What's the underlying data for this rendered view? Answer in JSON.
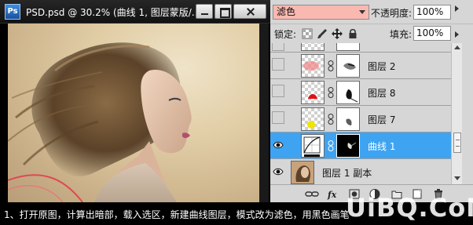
{
  "document": {
    "title": "PSD.psd @ 30.2% (曲线 1, 图层蒙版/...",
    "app_icon": "Ps"
  },
  "layers_panel": {
    "blend_mode": "滤色",
    "opacity_label": "不透明度:",
    "opacity_value": "100%",
    "lock_label": "锁定:",
    "fill_label": "填充:",
    "fill_value": "100%",
    "layers": [
      {
        "name": "图层 2",
        "visible": false,
        "thumb": "checker-pink",
        "has_mask": true
      },
      {
        "name": "图层 8",
        "visible": false,
        "thumb": "checker-red",
        "has_mask": true
      },
      {
        "name": "图层 7",
        "visible": false,
        "thumb": "checker-yellow",
        "has_mask": true
      },
      {
        "name": "曲线 1",
        "visible": true,
        "thumb": "curves-adjustment",
        "has_mask": true,
        "selected": true
      },
      {
        "name": "图层 1 副本",
        "visible": true,
        "thumb": "photo",
        "has_mask": false
      }
    ]
  },
  "caption": {
    "text": "1、打开原图，计算出暗部，载入选区，新建曲线图层，模式改为滤色，用黑色画笔"
  },
  "watermark": {
    "text": "UiBQ.CoM"
  },
  "colors": {
    "blend_field": "#f9b9b0",
    "selection": "#3ea4f2",
    "panel_bg": "#d6d6d6"
  }
}
